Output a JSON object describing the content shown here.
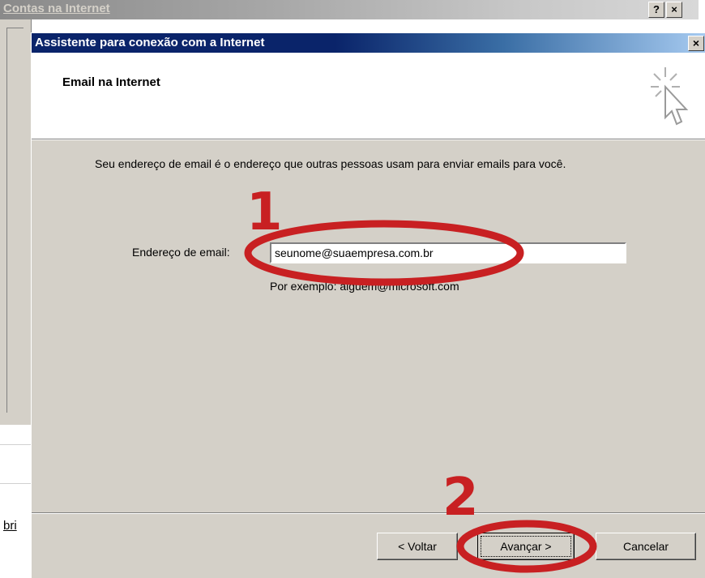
{
  "background_window": {
    "title": "Contas na Internet",
    "help_button": "?",
    "close_button": "×",
    "fragment_text": "bri"
  },
  "wizard": {
    "title": "Assistente para conexão com a Internet",
    "close_button": "×",
    "header_title": "Email na Internet",
    "header_icon": "wizard-cursor-icon",
    "description": "Seu endereço de email é o endereço que outras pessoas usam para enviar emails para você.",
    "email_label": "Endereço de email:",
    "email_value": "seunome@suaempresa.com.br",
    "example_text": "Por exemplo: alguem@microsoft.com",
    "buttons": {
      "back": "< Voltar",
      "next": "Avançar >",
      "cancel": "Cancelar"
    }
  },
  "annotations": {
    "step1": "1",
    "step2": "2",
    "color": "#c82022"
  },
  "colors": {
    "title_active": "#0a246a",
    "dialog_face": "#d4d0c8"
  }
}
